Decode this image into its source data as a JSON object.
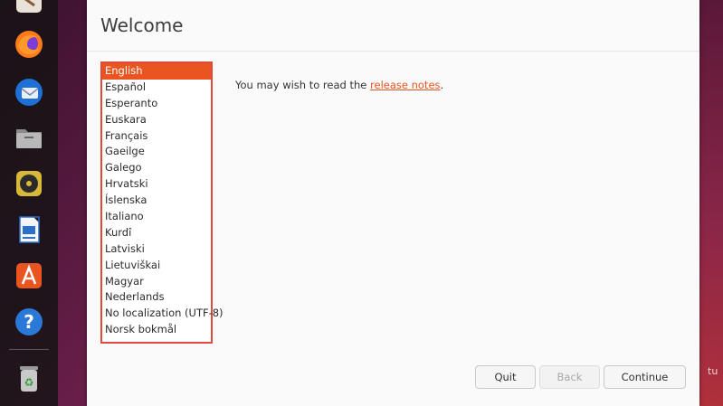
{
  "window": {
    "title": "Welcome"
  },
  "languages": {
    "selected_index": 0,
    "items": [
      "English",
      "Español",
      "Esperanto",
      "Euskara",
      "Français",
      "Gaeilge",
      "Galego",
      "Hrvatski",
      "Íslenska",
      "Italiano",
      "Kurdî",
      "Latviski",
      "Lietuviškai",
      "Magyar",
      "Nederlands",
      "No localization (UTF-8)",
      "Norsk bokmål"
    ]
  },
  "release": {
    "prefix": "You may wish to read the ",
    "link": "release notes",
    "suffix": "."
  },
  "buttons": {
    "quit": "Quit",
    "back": "Back",
    "continue": "Continue"
  },
  "dock": {
    "icons": [
      "text-editor-icon",
      "firefox-icon",
      "thunderbird-icon",
      "files-icon",
      "rhythmbox-icon",
      "writer-icon",
      "app-center-icon",
      "help-icon",
      "trash-icon"
    ]
  },
  "background": {
    "edge_text": "tu"
  },
  "colors": {
    "accent": "#e95420",
    "highlight_border": "#e04a3c"
  }
}
